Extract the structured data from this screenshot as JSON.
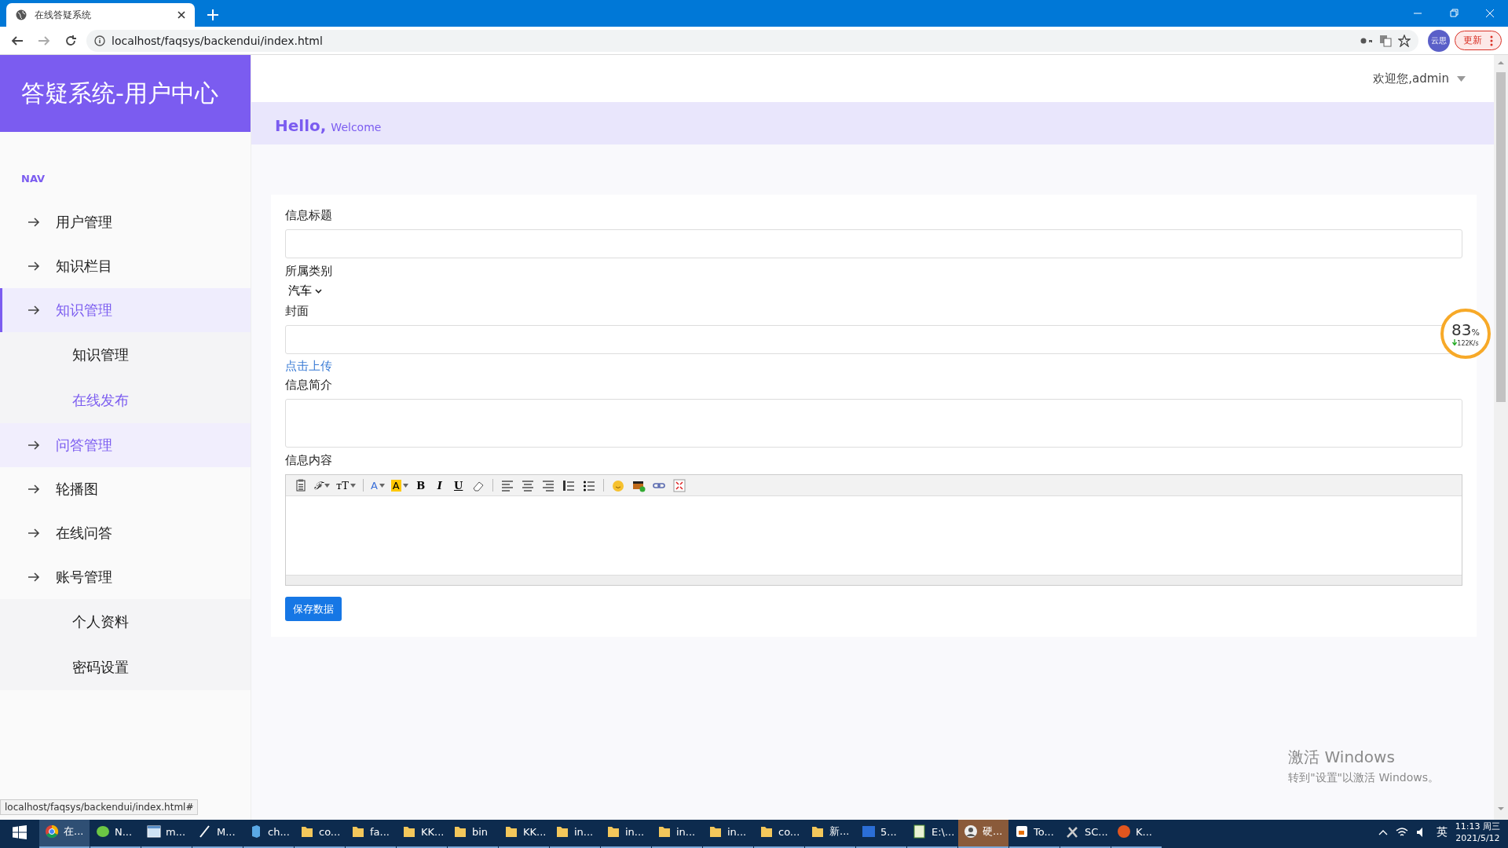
{
  "browser": {
    "tab_title": "在线答疑系统",
    "url": "localhost/faqsys/backendui/index.html",
    "profile": "云思",
    "update_button": "更新",
    "status_url": "localhost/faqsys/backendui/index.html#"
  },
  "sidebar": {
    "title": "答疑系统-用户中心",
    "nav_label": "NAV",
    "items": [
      {
        "label": "用户管理",
        "selected": false,
        "hovered": false
      },
      {
        "label": "知识栏目",
        "selected": false,
        "hovered": false
      },
      {
        "label": "知识管理",
        "selected": true,
        "hovered": false,
        "children": [
          {
            "label": "知识管理",
            "selected": false
          },
          {
            "label": "在线发布",
            "selected": true
          }
        ]
      },
      {
        "label": "问答管理",
        "selected": false,
        "hovered": true
      },
      {
        "label": "轮播图",
        "selected": false,
        "hovered": false
      },
      {
        "label": "在线问答",
        "selected": false,
        "hovered": false
      },
      {
        "label": "账号管理",
        "selected": false,
        "hovered": false,
        "children": [
          {
            "label": "个人资料",
            "selected": false
          },
          {
            "label": "密码设置",
            "selected": false
          }
        ]
      }
    ]
  },
  "header": {
    "user_menu": "欢迎您,admin",
    "hello": "Hello,",
    "welcome": "Welcome"
  },
  "form": {
    "fields": [
      {
        "kind": "input",
        "label": "信息标题"
      },
      {
        "kind": "select",
        "label": "所属类别",
        "value": "汽车"
      },
      {
        "kind": "upload",
        "label": "封面",
        "link": "点击上传"
      },
      {
        "kind": "textarea",
        "label": "信息简介"
      },
      {
        "kind": "editor",
        "label": "信息内容",
        "toolbar": [
          {
            "kind": "paste"
          },
          {
            "kind": "font",
            "label": "ℱ"
          },
          {
            "kind": "size",
            "label": "ᴛT"
          },
          {
            "kind": "sep"
          },
          {
            "kind": "forecolor",
            "label": "A"
          },
          {
            "kind": "backcolor",
            "label": "A"
          },
          {
            "kind": "bold",
            "label": "B"
          },
          {
            "kind": "italic",
            "label": "I"
          },
          {
            "kind": "underline",
            "label": "U"
          },
          {
            "kind": "eraser"
          },
          {
            "kind": "sep"
          },
          {
            "kind": "alignleft"
          },
          {
            "kind": "aligncenter"
          },
          {
            "kind": "alignright"
          },
          {
            "kind": "ol"
          },
          {
            "kind": "ul"
          },
          {
            "kind": "sep"
          },
          {
            "kind": "emoticon"
          },
          {
            "kind": "image"
          },
          {
            "kind": "link"
          },
          {
            "kind": "fullscreen"
          }
        ]
      }
    ],
    "submit": "保存数据"
  },
  "speed_widget": {
    "value": "83",
    "unit": "%",
    "speed": "122K/s"
  },
  "activation": {
    "title": "激活 Windows",
    "hint": "转到\"设置\"以激活 Windows。"
  },
  "taskbar": {
    "items": [
      {
        "kind": "browser",
        "label": "在...",
        "active": true
      },
      {
        "kind": "leaf",
        "label": "N...",
        "active": false
      },
      {
        "kind": "window",
        "label": "m...",
        "active": false
      },
      {
        "kind": "pen",
        "label": "M...",
        "active": false
      },
      {
        "kind": "cube",
        "label": "ch...",
        "active": false
      },
      {
        "kind": "folder",
        "label": "co...",
        "active": false
      },
      {
        "kind": "folder",
        "label": "fa...",
        "active": false
      },
      {
        "kind": "folder",
        "label": "KK...",
        "active": false
      },
      {
        "kind": "folder",
        "label": "bin",
        "active": false
      },
      {
        "kind": "folder",
        "label": "KK...",
        "active": false
      },
      {
        "kind": "folder",
        "label": "in...",
        "active": false
      },
      {
        "kind": "folder",
        "label": "in...",
        "active": false
      },
      {
        "kind": "folder",
        "label": "in...",
        "active": false
      },
      {
        "kind": "folder",
        "label": "in...",
        "active": false
      },
      {
        "kind": "folder",
        "label": "co...",
        "active": false
      },
      {
        "kind": "folder",
        "label": "新...",
        "active": false
      },
      {
        "kind": "doc",
        "label": "5...",
        "active": false
      },
      {
        "kind": "sheet",
        "label": "E:\\...",
        "active": false
      },
      {
        "kind": "avatar",
        "label": "硬...",
        "active": true
      },
      {
        "kind": "cup",
        "label": "To...",
        "active": false
      },
      {
        "kind": "tools",
        "label": "SC...",
        "active": false
      },
      {
        "kind": "orb",
        "label": "K...",
        "active": false
      }
    ],
    "ime": "英",
    "time": "11:13 周三",
    "date": "2021/5/12"
  }
}
